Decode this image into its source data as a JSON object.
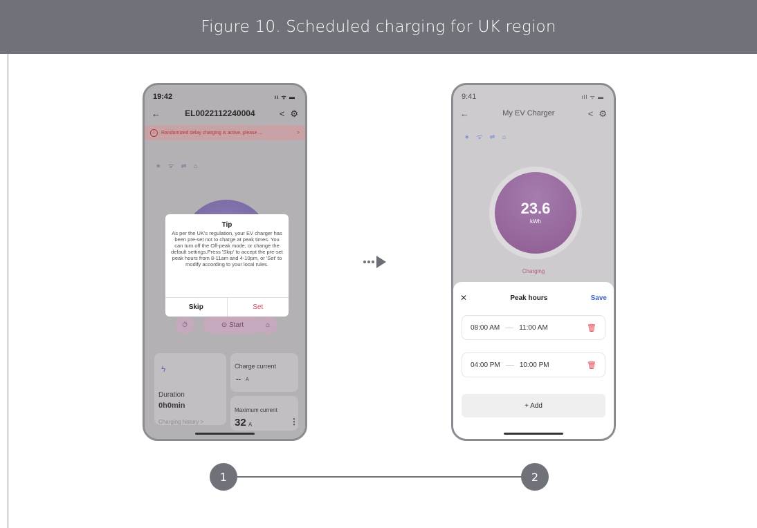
{
  "figure": {
    "title": "Figure 10.   Scheduled charging for UK region"
  },
  "phone1": {
    "time": "19:42",
    "status_icons": "ıı ᯤ ▬",
    "charger_id": "EL0022112240004",
    "warning": "Randomized delay charging is active, please ...",
    "connectivity": "∗ ᯤ ⇌ ⌂",
    "controls": {
      "start": "Start"
    },
    "stats": {
      "charge_current_label": "Charge current",
      "charge_current_value": "--",
      "charge_current_unit": "A",
      "duration_label": "Duration",
      "duration_value": "0h0min",
      "charging_history": "Charging history  >",
      "max_current_label": "Maximum current",
      "max_current_value": "32",
      "max_current_unit": "A"
    },
    "dialog": {
      "title": "Tip",
      "body": "As per the UK's regulation, your EV charger has been pre-set not to charge at peak times. You can turn off the Off-peak mode, or change the default settings.Press 'Skip' to accept the pre-set peak hours from 8-11am and 4-10pm, or 'Set' to modify according to your local rules.",
      "skip": "Skip",
      "set": "Set"
    }
  },
  "phone2": {
    "time": "9:41",
    "status_icons": "ıll ᯤ ▬",
    "title": "My EV Charger",
    "connectivity": "∗ ᯤ ⇌ ⌂",
    "gauge": {
      "value": "23.6",
      "unit": "kWh"
    },
    "status": "Charging",
    "sheet": {
      "close": "✕",
      "title": "Peak hours",
      "save": "Save",
      "rows": [
        {
          "start": "08:00 AM",
          "end": "11:00 AM"
        },
        {
          "start": "04:00 PM",
          "end": "10:00 PM"
        }
      ],
      "add": "+  Add"
    }
  },
  "steps": [
    "1",
    "2"
  ]
}
